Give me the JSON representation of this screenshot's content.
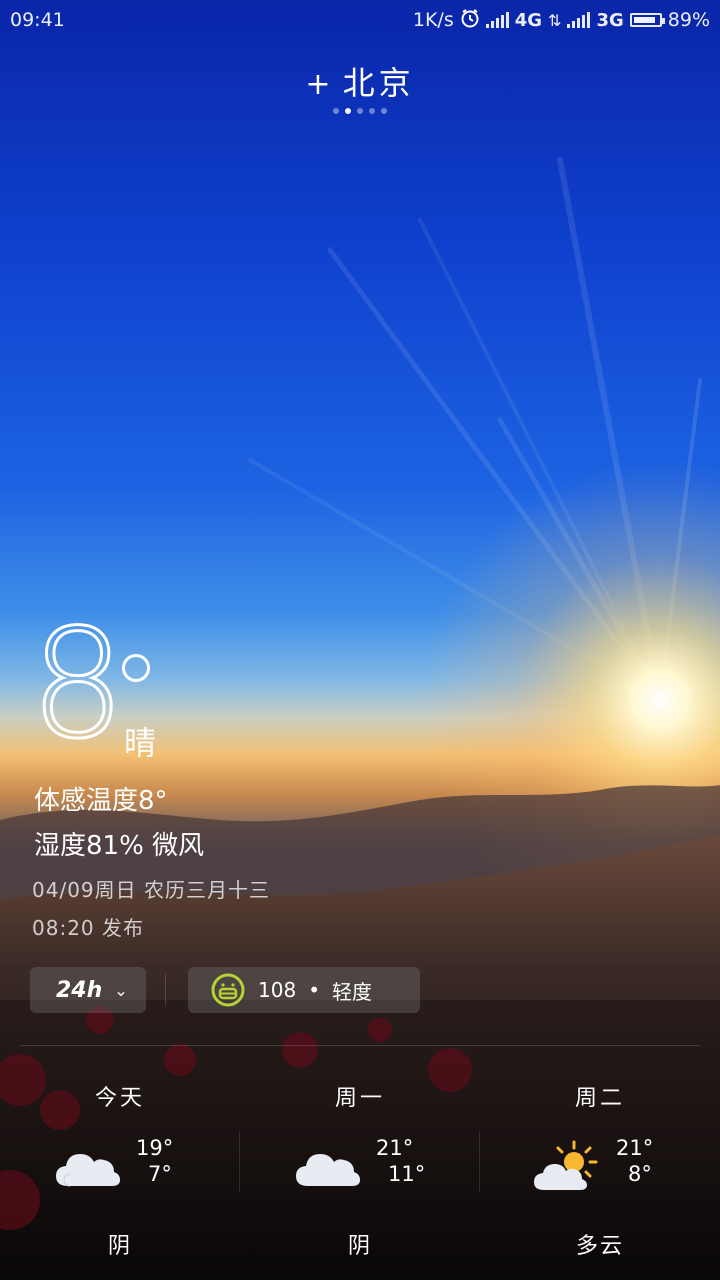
{
  "status": {
    "time": "09:41",
    "speed": "1K/s",
    "network1": "4G",
    "network2": "3G",
    "battery_pct": "89%",
    "battery_level": 0.89
  },
  "header": {
    "add_icon": "+",
    "city": "北京",
    "pages_total": 5,
    "active_page": 2
  },
  "current": {
    "temp": "8",
    "condition": "晴",
    "feels_like": "体感温度8°",
    "humidity_wind": "湿度81% 微风",
    "date_line": "04/09周日  农历三月十三",
    "publish_line": "08:20 发布"
  },
  "controls": {
    "hourly_label": "24h",
    "aqi_value": "108",
    "aqi_bullet": "•",
    "aqi_level": "轻度",
    "aqi_color": "#b5d334"
  },
  "forecast": [
    {
      "day": "今天",
      "icon": "cloud-icon",
      "high": "19°",
      "low": "7°",
      "desc": "阴"
    },
    {
      "day": "周一",
      "icon": "cloud-icon",
      "high": "21°",
      "low": "11°",
      "desc": "阴"
    },
    {
      "day": "周二",
      "icon": "partly-sunny-icon",
      "high": "21°",
      "low": "8°",
      "desc": "多云"
    }
  ]
}
